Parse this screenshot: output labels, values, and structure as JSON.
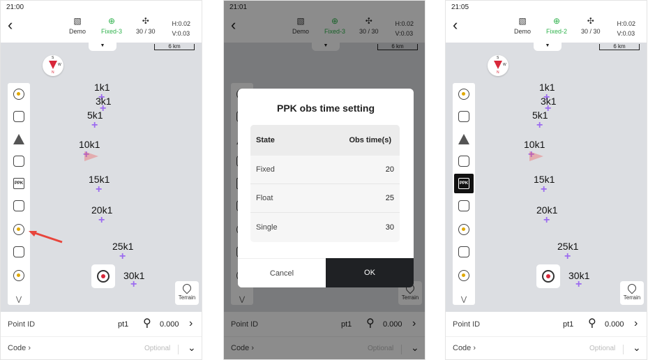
{
  "panels": [
    {
      "time": "21:00",
      "toolbar": {
        "base_label": "Demo",
        "solution_label": "Fixed-3",
        "sats": "30 / 30",
        "h": "H:0.02",
        "v": "V:0.03"
      },
      "scale_label": "6 km",
      "compass": {
        "s": "S",
        "w": "W",
        "n": "N"
      },
      "points": [
        "1k1",
        "3k1",
        "5k1",
        "10k1",
        "15k1",
        "20k1",
        "25k1",
        "30k1"
      ],
      "terrain_label": "Terrain",
      "bottom": {
        "point_id_label": "Point ID",
        "point_id_value": "pt1",
        "height_value": "0.000",
        "code_label": "Code",
        "code_placeholder": "Optional"
      }
    },
    {
      "time": "21:01",
      "toolbar": {
        "base_label": "Demo",
        "solution_label": "Fixed-3",
        "sats": "30 / 30",
        "h": "H:0.02",
        "v": "V:0.03"
      },
      "scale_label": "6 km",
      "terrain_label": "Terrain",
      "bottom": {
        "point_id_label": "Point ID",
        "point_id_value": "pt1",
        "height_value": "0.000",
        "code_label": "Code",
        "code_placeholder": "Optional"
      },
      "dialog": {
        "title": "PPK obs time setting",
        "col_state": "State",
        "col_time": "Obs time(s)",
        "rows": [
          {
            "state": "Fixed",
            "time": "20"
          },
          {
            "state": "Float",
            "time": "25"
          },
          {
            "state": "Single",
            "time": "30"
          }
        ],
        "cancel": "Cancel",
        "ok": "OK"
      }
    },
    {
      "time": "21:05",
      "toolbar": {
        "base_label": "Demo",
        "solution_label": "Fixed-2",
        "sats": "30 / 30",
        "h": "H:0.02",
        "v": "V:0.03"
      },
      "scale_label": "6 km",
      "compass": {
        "s": "S",
        "w": "W",
        "n": "N"
      },
      "points": [
        "1k1",
        "3k1",
        "5k1",
        "10k1",
        "15k1",
        "20k1",
        "25k1",
        "30k1"
      ],
      "terrain_label": "Terrain",
      "bottom": {
        "point_id_label": "Point ID",
        "point_id_value": "pt1",
        "height_value": "0.000",
        "code_label": "Code",
        "code_placeholder": "Optional"
      }
    }
  ],
  "icons": {
    "back": "chevron-left-icon",
    "base": "base-station-icon",
    "solution": "gnss-fix-icon",
    "sats": "satellite-icon",
    "rod": "survey-pole-icon",
    "next": "chevron-right-icon",
    "dropdown": "chevron-down-icon"
  },
  "colors": {
    "fix_green": "#2fb24c",
    "point_purple": "#9c6bf0",
    "accent_red": "#d8283a",
    "ok_button": "#1f2124"
  }
}
